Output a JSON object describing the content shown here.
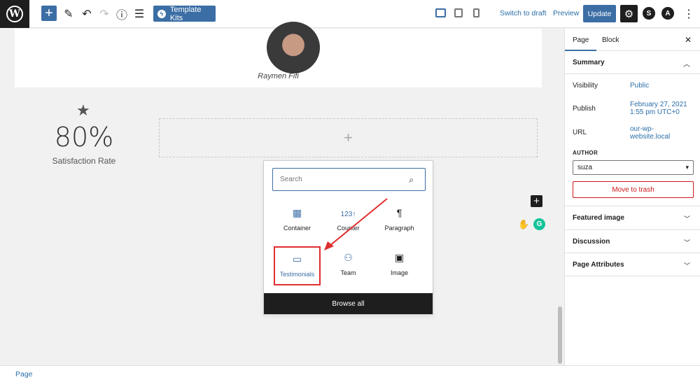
{
  "toolbar": {
    "template_kits": "Template Kits",
    "switch_draft": "Switch to draft",
    "preview": "Preview",
    "update": "Update"
  },
  "canvas": {
    "person_name": "Raymen Fifi",
    "stat_value": "80%",
    "stat_label": "Satisfaction Rate"
  },
  "inserter": {
    "search_placeholder": "Search",
    "blocks": [
      {
        "label": "Container",
        "icon": "container-icon"
      },
      {
        "label": "Counter",
        "icon": "counter-icon"
      },
      {
        "label": "Paragraph",
        "icon": "paragraph-icon"
      },
      {
        "label": "Testimonials",
        "icon": "testimonials-icon"
      },
      {
        "label": "Team",
        "icon": "team-icon"
      },
      {
        "label": "Image",
        "icon": "image-icon"
      }
    ],
    "counter_glyph": "123↑",
    "browse_all": "Browse all",
    "highlight_color": "#e02e2e"
  },
  "sidebar": {
    "tabs": [
      "Page",
      "Block"
    ],
    "summary_title": "Summary",
    "visibility_label": "Visibility",
    "visibility_value": "Public",
    "publish_label": "Publish",
    "publish_value_line1": "February 27, 2021",
    "publish_value_line2": "1:55 pm UTC+0",
    "url_label": "URL",
    "url_value_line1": "our-wp-",
    "url_value_line2": "website.local",
    "author_label": "AUTHOR",
    "author_value": "suza",
    "trash_label": "Move to trash",
    "sections": [
      "Featured image",
      "Discussion",
      "Page Attributes"
    ]
  },
  "footer": {
    "breadcrumb": "Page"
  },
  "colors": {
    "accent": "#3b6ea5",
    "danger": "#cc1818",
    "dark": "#1e1e1e"
  }
}
